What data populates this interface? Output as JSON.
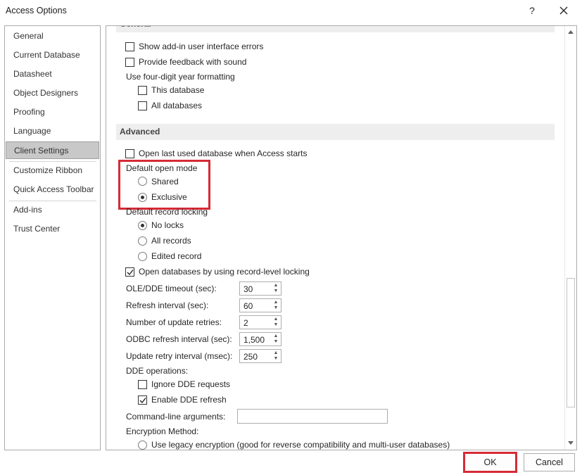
{
  "window": {
    "title": "Access Options",
    "help_label": "?"
  },
  "nav": {
    "items": [
      {
        "label": "General"
      },
      {
        "label": "Current Database"
      },
      {
        "label": "Datasheet"
      },
      {
        "label": "Object Designers"
      },
      {
        "label": "Proofing"
      },
      {
        "label": "Language"
      },
      {
        "label": "Client Settings",
        "selected": true
      },
      {
        "label": "Customize Ribbon"
      },
      {
        "label": "Quick Access Toolbar"
      },
      {
        "label": "Add-ins"
      },
      {
        "label": "Trust Center"
      }
    ]
  },
  "general": {
    "header_partial": "General",
    "show_addin_errors": {
      "label": "Show add-in user interface errors",
      "checked": false
    },
    "feedback_sound": {
      "label": "Provide feedback with sound",
      "checked": false
    },
    "four_digit_label": "Use four-digit year formatting",
    "this_database": {
      "label": "This database",
      "checked": false
    },
    "all_databases": {
      "label": "All databases",
      "checked": false
    }
  },
  "advanced": {
    "header": "Advanced",
    "open_last_db": {
      "label": "Open last used database when Access starts",
      "checked": false
    },
    "default_open_mode_label": "Default open mode",
    "shared": {
      "label": "Shared",
      "selected": false
    },
    "exclusive": {
      "label": "Exclusive",
      "selected": true
    },
    "default_record_locking_label": "Default record locking",
    "no_locks": {
      "label": "No locks",
      "selected": true
    },
    "all_records": {
      "label": "All records",
      "selected": false
    },
    "edited_record": {
      "label": "Edited record",
      "selected": false
    },
    "record_level_locking": {
      "label": "Open databases by using record-level locking",
      "checked": true
    },
    "ole_dde_timeout": {
      "label": "OLE/DDE timeout (sec):",
      "value": "30"
    },
    "refresh_interval": {
      "label": "Refresh interval (sec):",
      "value": "60"
    },
    "update_retries": {
      "label": "Number of update retries:",
      "value": "2"
    },
    "odbc_refresh": {
      "label": "ODBC refresh interval (sec):",
      "value": "1,500"
    },
    "update_retry_interval": {
      "label": "Update retry interval (msec):",
      "value": "250"
    },
    "dde_operations_label": "DDE operations:",
    "ignore_dde": {
      "label": "Ignore DDE requests",
      "checked": false
    },
    "enable_dde_refresh": {
      "label": "Enable DDE refresh",
      "checked": true
    },
    "command_line_label": "Command-line arguments:",
    "command_line_value": "",
    "encryption_label": "Encryption Method:",
    "legacy_encryption": {
      "label": "Use legacy encryption (good for reverse compatibility and multi-user databases)",
      "selected": false
    }
  },
  "buttons": {
    "ok": "OK",
    "cancel": "Cancel"
  },
  "colors": {
    "highlight": "#d62a36",
    "selected_nav": "#c8c8c8"
  }
}
